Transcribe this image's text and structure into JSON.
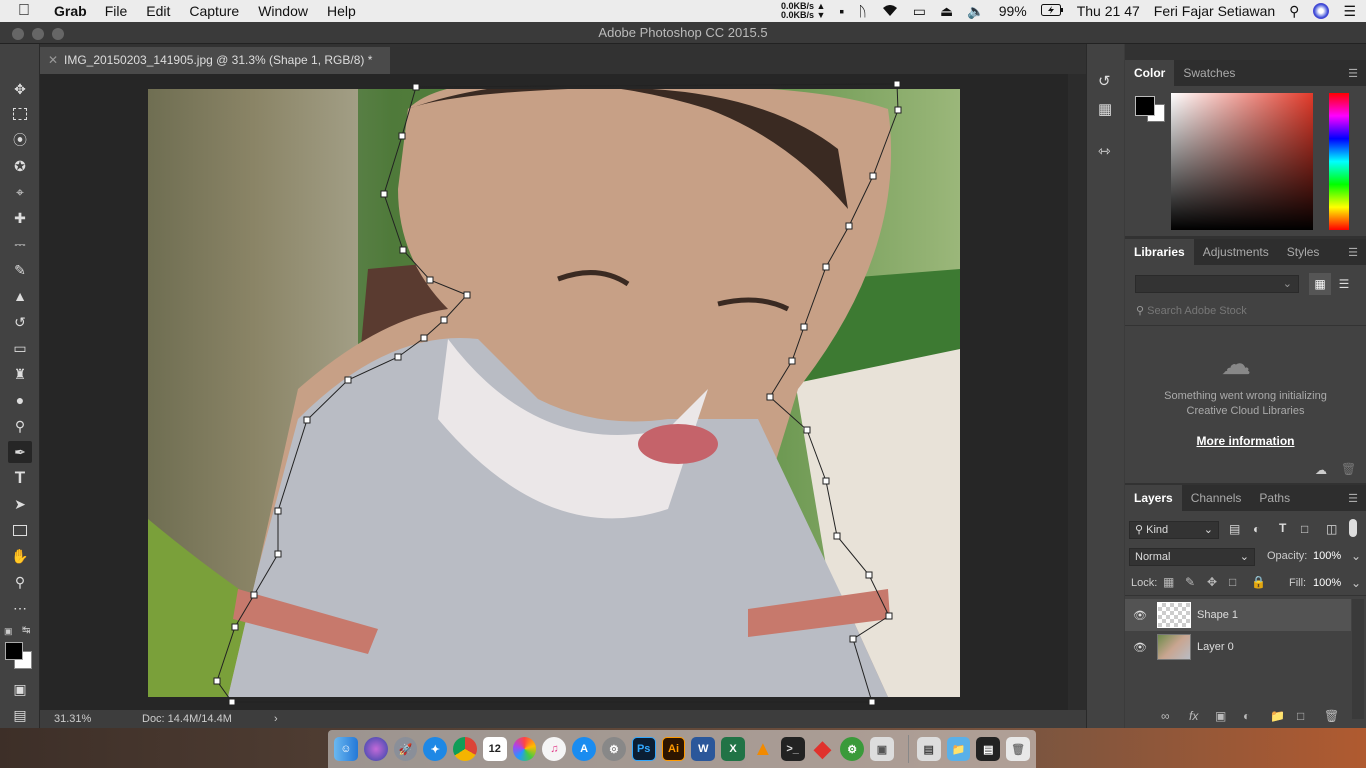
{
  "menubar": {
    "apple_icon": "apple-icon",
    "app_name": "Grab",
    "items": [
      "File",
      "Edit",
      "Capture",
      "Window",
      "Help"
    ],
    "net_up": "0.0KB/s",
    "net_down": "0.0KB/s",
    "battery": "99%",
    "clock": "Thu 21 47",
    "user": "Feri Fajar Setiawan"
  },
  "window": {
    "title": "Adobe Photoshop CC 2015.5"
  },
  "document": {
    "tab_title": "IMG_20150203_141905.jpg @ 31.3% (Shape 1, RGB/8) *",
    "zoom": "31.31%",
    "doc_size": "Doc: 14.4M/14.4M"
  },
  "color_panel": {
    "tabs": [
      "Color",
      "Swatches"
    ],
    "foreground": "#000000",
    "background": "#ffffff",
    "hue_color": "#e23a2a"
  },
  "libraries_panel": {
    "tabs": [
      "Libraries",
      "Adjustments",
      "Styles"
    ],
    "search_placeholder": "Search Adobe Stock",
    "error_line1": "Something went wrong initializing",
    "error_line2": "Creative Cloud Libraries",
    "more_info": "More information"
  },
  "layers_panel": {
    "tabs": [
      "Layers",
      "Channels",
      "Paths"
    ],
    "filter_kind": "Kind",
    "blend_mode": "Normal",
    "opacity_label": "Opacity:",
    "opacity": "100%",
    "lock_label": "Lock:",
    "fill_label": "Fill:",
    "fill": "100%",
    "layers": [
      {
        "name": "Shape 1",
        "selected": true
      },
      {
        "name": "Layer 0",
        "selected": false
      }
    ]
  },
  "dock": {
    "apps": [
      "finder",
      "siri",
      "launchpad",
      "safari",
      "chrome",
      "calendar",
      "photos",
      "itunes",
      "app-store",
      "system-preferences",
      "photoshop",
      "illustrator",
      "word",
      "excel",
      "vlc",
      "terminal",
      "anydesk",
      "xcode-helper",
      "preview",
      "folder",
      "screenshot",
      "trash"
    ],
    "calendar_day": "12",
    "ps_label": "Ps",
    "ai_label": "Ai",
    "word_label": "W",
    "excel_label": "X"
  }
}
